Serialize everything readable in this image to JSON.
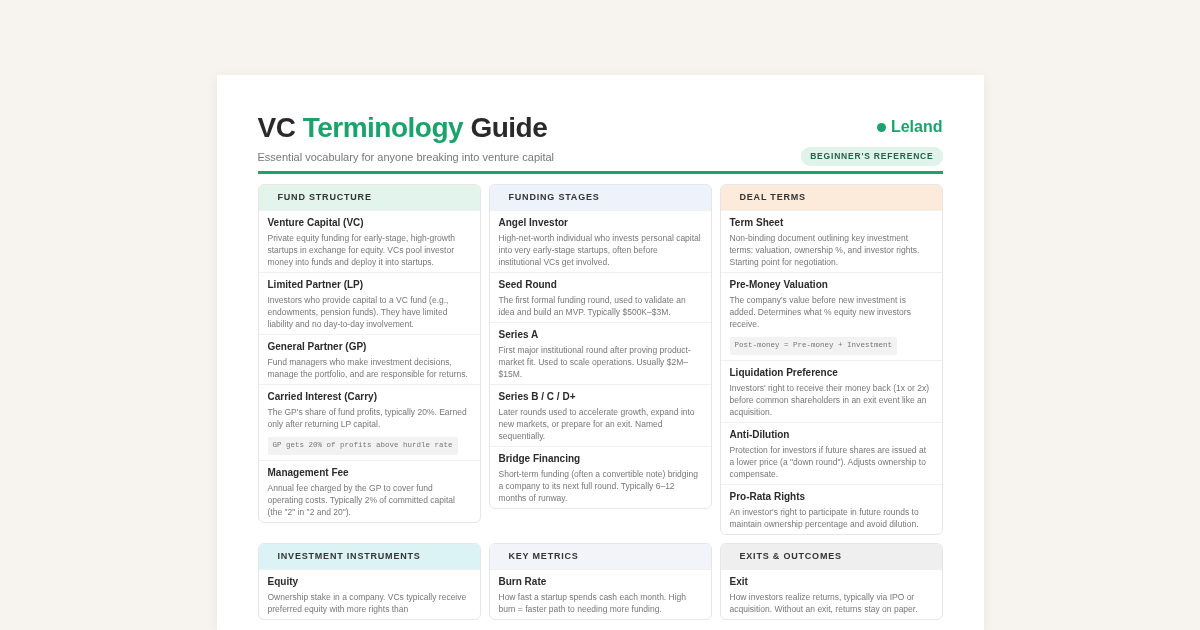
{
  "header": {
    "title": [
      {
        "text": "VC ",
        "accent": false
      },
      {
        "text": "Terminology",
        "accent": true
      },
      {
        "text": " Guide",
        "accent": false
      }
    ],
    "subtitle": "Essential vocabulary for anyone breaking into venture capital",
    "brand": "Leland",
    "badge": "BEGINNER'S REFERENCE"
  },
  "sections": [
    {
      "title": "FUND STRUCTURE",
      "color": "#e2f4eb",
      "terms": [
        {
          "name": "Venture Capital (VC)",
          "text": "Private equity funding for early-stage, high-growth startups in exchange for equity. VCs pool investor money into funds and deploy it into startups."
        },
        {
          "name": "Limited Partner (LP)",
          "text": "Investors who provide capital to a VC fund (e.g., endowments, pension funds). They have limited liability and no day-to-day involvement."
        },
        {
          "name": "General Partner (GP)",
          "text": "Fund managers who make investment decisions, manage the portfolio, and are responsible for returns."
        },
        {
          "name": "Carried Interest (Carry)",
          "text": "The GP's share of fund profits, typically 20%. Earned only after returning LP capital.",
          "code": "GP gets 20% of profits above hurdle rate"
        },
        {
          "name": "Management Fee",
          "text": "Annual fee charged by the GP to cover fund operating costs. Typically 2% of committed capital (the \"2\" in \"2 and 20\")."
        }
      ]
    },
    {
      "title": "FUNDING STAGES",
      "color": "#edf2fb",
      "terms": [
        {
          "name": "Angel Investor",
          "text": "High-net-worth individual who invests personal capital into very early-stage startups, often before institutional VCs get involved."
        },
        {
          "name": "Seed Round",
          "text": "The first formal funding round, used to validate an idea and build an MVP. Typically $500K–$3M."
        },
        {
          "name": "Series A",
          "text": "First major institutional round after proving product-market fit. Used to scale operations. Usually $2M–$15M."
        },
        {
          "name": "Series B / C / D+",
          "text": "Later rounds used to accelerate growth, expand into new markets, or prepare for an exit. Named sequentially."
        },
        {
          "name": "Bridge Financing",
          "text": "Short-term funding (often a convertible note) bridging a company to its next full round. Typically 6–12 months of runway."
        }
      ]
    },
    {
      "title": "DEAL TERMS",
      "color": "#fcebdb",
      "terms": [
        {
          "name": "Term Sheet",
          "text": "Non-binding document outlining key investment terms: valuation, ownership %, and investor rights. Starting point for negotiation."
        },
        {
          "name": "Pre-Money Valuation",
          "text": "The company's value before new investment is added. Determines what % equity new investors receive.",
          "code": "Post-money = Pre-money + Investment"
        },
        {
          "name": "Liquidation Preference",
          "text": "Investors' right to receive their money back (1x or 2x) before common shareholders in an exit event like an acquisition."
        },
        {
          "name": "Anti-Dilution",
          "text": "Protection for investors if future shares are issued at a lower price (a \"down round\"). Adjusts ownership to compensate."
        },
        {
          "name": "Pro-Rata Rights",
          "text": "An investor's right to participate in future rounds to maintain ownership percentage and avoid dilution."
        }
      ]
    },
    {
      "title": "INVESTMENT INSTRUMENTS",
      "color": "#dbf3f5",
      "terms": [
        {
          "name": "Equity",
          "text": "Ownership stake in a company. VCs typically receive preferred equity with more rights than"
        }
      ]
    },
    {
      "title": "KEY METRICS",
      "color": "#f3f4f9",
      "terms": [
        {
          "name": "Burn Rate",
          "text": "How fast a startup spends cash each month. High burn = faster path to needing more funding."
        }
      ]
    },
    {
      "title": "EXITS & OUTCOMES",
      "color": "#efefef",
      "terms": [
        {
          "name": "Exit",
          "text": "How investors realize returns, typically via IPO or acquisition. Without an exit, returns stay on paper."
        }
      ]
    }
  ]
}
